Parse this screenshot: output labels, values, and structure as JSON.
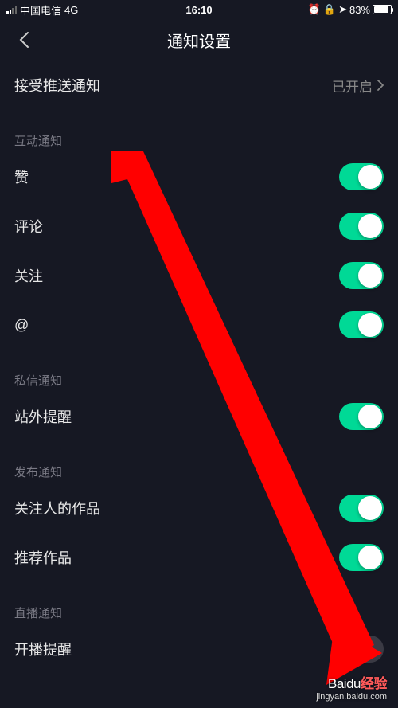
{
  "status": {
    "carrier": "中国电信",
    "network": "4G",
    "time": "16:10",
    "battery_pct": "83%"
  },
  "nav": {
    "title": "通知设置"
  },
  "push": {
    "label": "接受推送通知",
    "value": "已开启"
  },
  "sections": {
    "interaction": {
      "header": "互动通知",
      "like": {
        "label": "赞",
        "on": true
      },
      "comment": {
        "label": "评论",
        "on": true
      },
      "follow": {
        "label": "关注",
        "on": true
      },
      "mention": {
        "label": "@",
        "on": true
      }
    },
    "dm": {
      "header": "私信通知",
      "external": {
        "label": "站外提醒",
        "on": true
      }
    },
    "publish": {
      "header": "发布通知",
      "followed_works": {
        "label": "关注人的作品",
        "on": true
      },
      "recommended": {
        "label": "推荐作品",
        "on": true
      }
    },
    "live": {
      "header": "直播通知",
      "start": {
        "label": "开播提醒",
        "on": false
      }
    }
  },
  "watermark": {
    "brand": "Baidu",
    "suffix": "经验",
    "url": "jingyan.baidu.com"
  }
}
